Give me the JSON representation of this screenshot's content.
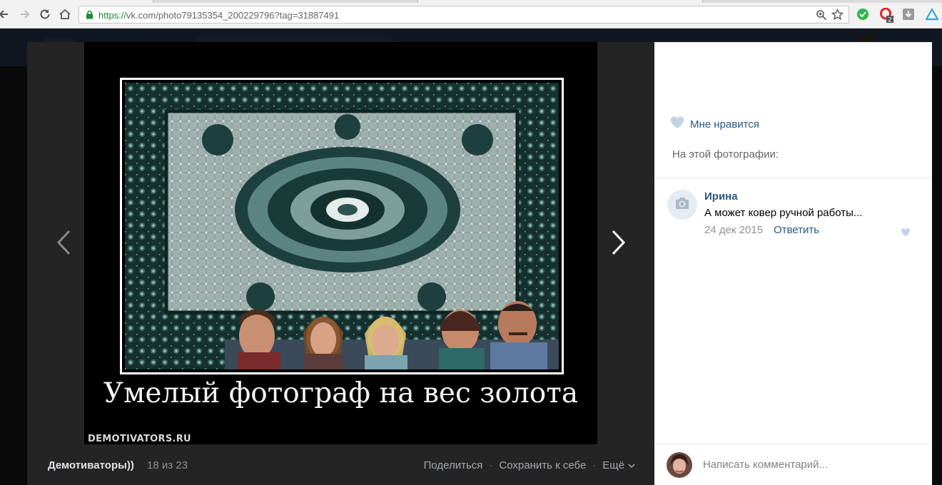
{
  "browser": {
    "url_scheme": "https://",
    "url_rest": "vk.com/photo79135354_200229796?tag=31887491",
    "opera_badge": "2"
  },
  "photo": {
    "caption": "Умелый фотограф на вес золота",
    "watermark": "DEMOTIVATORS.RU"
  },
  "viewer": {
    "album": "Демотиваторы))",
    "counter": "18 из 23",
    "share": "Поделиться",
    "save": "Сохранить к себе",
    "more": "Ещё"
  },
  "panel": {
    "like_label": "Мне нравится",
    "on_photo_label": "На этой фотографии:",
    "comment": {
      "author": "Ирина",
      "text": "А может ковер ручной работы...",
      "date": "24 дек 2015",
      "reply": "Ответить"
    },
    "composer_placeholder": "Написать комментарий..."
  },
  "colors": {
    "vk_link": "#2a5885",
    "vk_header": "#2b3d55",
    "viewer_bg": "#242424"
  }
}
